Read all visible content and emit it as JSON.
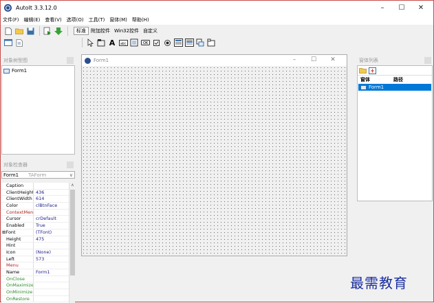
{
  "window": {
    "title": "AutoIt 3.3.12.0",
    "controls": [
      "–",
      "☐",
      "✕"
    ]
  },
  "menu": [
    "文件(F)",
    "编辑(E)",
    "查看(V)",
    "选项(O)",
    "工具(T)",
    "窗体(M)",
    "帮助(H)"
  ],
  "toolbar": {
    "row1_left": [
      "new-file",
      "open-folder",
      "save"
    ],
    "row1_mid": [
      "run",
      "run-green"
    ],
    "tabs": [
      "标准",
      "附加控件",
      "Win32控件",
      "自定义"
    ],
    "active_tab": 0,
    "row2_left": [
      "form-icon",
      "script-icon"
    ],
    "controls": [
      "pointer",
      "group",
      "label",
      "input",
      "edit",
      "button",
      "checkbox",
      "radio",
      "combo",
      "list",
      "date",
      "tab"
    ]
  },
  "tree_panel": {
    "title": "对象树型图",
    "items": [
      "Form1"
    ]
  },
  "inspector": {
    "title": "对象检查器",
    "object": "Form1",
    "object_class": "TAForm",
    "properties": [
      {
        "name": "Caption",
        "value": "",
        "style": "normal"
      },
      {
        "name": "ClientHeight",
        "value": "436",
        "style": "normal"
      },
      {
        "name": "ClientWidth",
        "value": "614",
        "style": "normal"
      },
      {
        "name": "Color",
        "value": "clBtnFace",
        "style": "normal"
      },
      {
        "name": "ContextMenu",
        "value": "",
        "style": "red"
      },
      {
        "name": "Cursor",
        "value": "crDefault",
        "style": "normal"
      },
      {
        "name": "Enabled",
        "value": "True",
        "style": "normal"
      },
      {
        "name": "⊞Font",
        "value": "(TFont)",
        "style": "expand"
      },
      {
        "name": "Height",
        "value": "475",
        "style": "normal"
      },
      {
        "name": "Hint",
        "value": "",
        "style": "normal"
      },
      {
        "name": "Icon",
        "value": "(None)",
        "style": "normal"
      },
      {
        "name": "Left",
        "value": "573",
        "style": "normal"
      },
      {
        "name": "Menu",
        "value": "",
        "style": "red"
      },
      {
        "name": "Name",
        "value": "Form1",
        "style": "normal"
      },
      {
        "name": "OnClose",
        "value": "",
        "style": "green"
      },
      {
        "name": "OnMaximize",
        "value": "",
        "style": "green"
      },
      {
        "name": "OnMinimize",
        "value": "",
        "style": "green"
      },
      {
        "name": "OnRestore",
        "value": "",
        "style": "green"
      }
    ]
  },
  "form_window": {
    "title": "Form1",
    "controls": [
      "–",
      "☐",
      "✕"
    ]
  },
  "window_list": {
    "title": "窗体列表",
    "headers": [
      "窗体",
      "路径"
    ],
    "rows": [
      {
        "name": "Form1",
        "path": ""
      }
    ]
  },
  "watermark": "最需教育"
}
